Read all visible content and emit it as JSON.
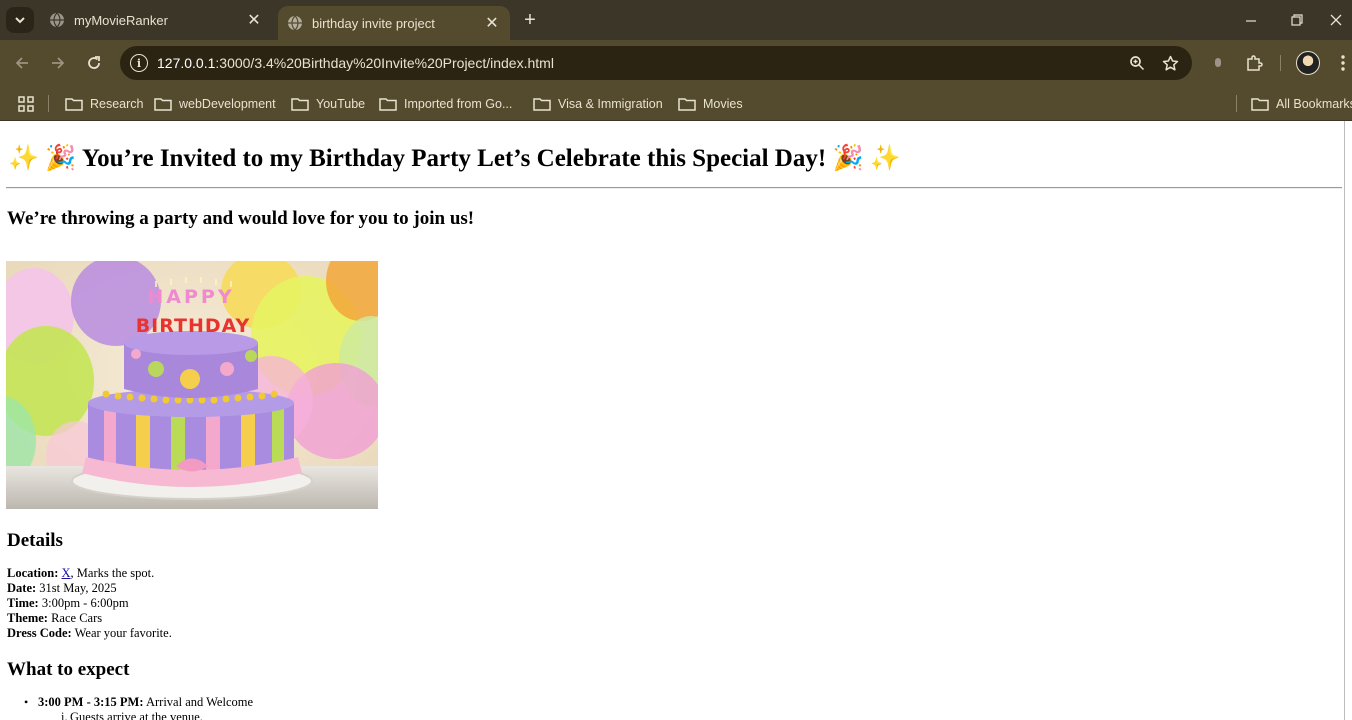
{
  "browser": {
    "tabs": [
      {
        "title": "myMovieRanker",
        "active": false
      },
      {
        "title": "birthday invite project",
        "active": true
      }
    ],
    "url": {
      "host": "127.0.0.1",
      "path": ":3000/3.4%20Birthday%20Invite%20Project/index.html"
    },
    "bookmarks": [
      "Research",
      "webDevelopment",
      "YouTube",
      "Imported from Go...",
      "Visa & Immigration",
      "Movies"
    ],
    "all_bookmarks": "All Bookmarks",
    "colors": {
      "frame": "#3c3628",
      "toolbar": "#544a2d",
      "omnibox": "#2b2413",
      "text": "#e8e2d0"
    }
  },
  "page": {
    "heading": "✨ 🎉 You’re Invited to my Birthday Party Let’s Celebrate this Special Day! 🎉 ✨",
    "tagline": "We’re throwing a party and would love for you to join us!",
    "cake_image": {
      "top_text": "HAPPY",
      "bottom_text": "BIRTHDAY",
      "alt": "birthday cake"
    },
    "details": {
      "title": "Details",
      "location_label": "Location:",
      "location_link": "X",
      "location_rest": ", Marks the spot.",
      "date_label": "Date:",
      "date_value": "31st May, 2025",
      "time_label": "Time:",
      "time_value": "3:00pm - 6:00pm",
      "theme_label": "Theme:",
      "theme_value": "Race Cars",
      "dress_label": "Dress Code:",
      "dress_value": "Wear your favorite."
    },
    "expect": {
      "title": "What to expect",
      "items": [
        {
          "time": "3:00 PM - 3:15 PM:",
          "text": "Arrival and Welcome",
          "sub_num": "i.",
          "sub_text": "Guests arrive at the venue."
        }
      ]
    }
  }
}
